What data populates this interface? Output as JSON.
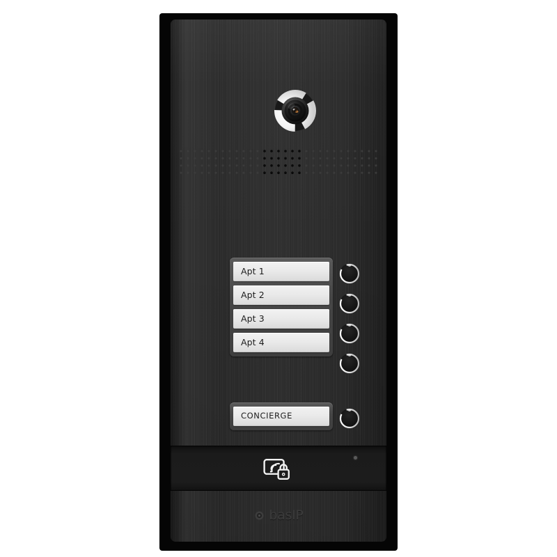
{
  "device": {
    "name": "BAS-IP multi-apartment video door station",
    "brand_text": "basIP",
    "brand_mark_icon": "circle-logo-icon",
    "panel_color": "#2c2c2c",
    "frame_color": "#050505",
    "background_color": "#ffffff",
    "accent_color": "#eaeaea",
    "rfid_band_color": "#1b1b1b"
  },
  "camera": {
    "icon": "camera-lens-icon",
    "ring_color": "#f0f0f0",
    "lens_color": "#1a1a1a",
    "iris_color": "#b4743a"
  },
  "speaker": {
    "icon": "speaker-grille-icon",
    "rows": 4,
    "columns": 29,
    "active_column_start": 12,
    "active_column_end": 17,
    "dot_color_inactive": "#3c3c3c",
    "dot_color_active": "#0a0a0a"
  },
  "call_units": [
    {
      "label": "Apt 1",
      "button_icon": "call-button-icon"
    },
    {
      "label": "Apt 2",
      "button_icon": "call-button-icon"
    },
    {
      "label": "Apt 3",
      "button_icon": "call-button-icon"
    },
    {
      "label": "Apt 4",
      "button_icon": "call-button-icon"
    }
  ],
  "concierge": {
    "label": "CONCIERGE",
    "button_icon": "call-button-icon"
  },
  "rfid": {
    "icon": "rfid-card-lock-icon",
    "led_icon": "status-led-icon",
    "led_color": "#5a5a5a"
  }
}
